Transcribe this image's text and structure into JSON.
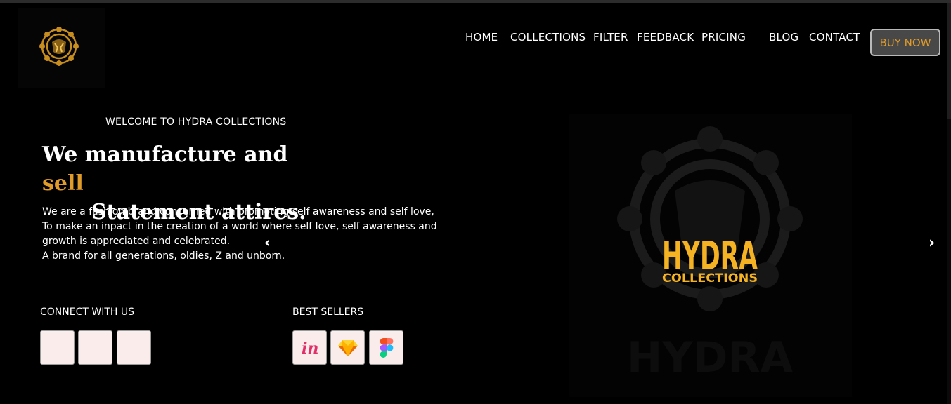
{
  "nav": {
    "items": [
      {
        "label": "HOME",
        "name": "nav-home"
      },
      {
        "label": "COLLECTIONS",
        "name": "nav-collections"
      },
      {
        "label": "FILTER",
        "name": "nav-filter"
      },
      {
        "label": "FEEDBACK",
        "name": "nav-feedback"
      },
      {
        "label": "PRICING",
        "name": "nav-pricing"
      },
      {
        "label": "BLOG",
        "name": "nav-blog"
      },
      {
        "label": "CONTACT",
        "name": "nav-contact"
      }
    ],
    "buy_label": "BUY NOW"
  },
  "hero": {
    "welcome": "WELCOME TO HYDRA COLLECTIONS",
    "headline_part1": "We manufacture and ",
    "headline_accent": "sell",
    "headline_line2": "Statement attires.",
    "description": [
      "We are a fashion brand concerned with promoting self awareness and self love,",
      "To make an inpact in the creation of a world where self love, self awareness and",
      "growth is appreciated and celebrated.",
      "A brand for all generations, oldies, Z and unborn."
    ]
  },
  "connect": {
    "title": "CONNECT WITH US",
    "icons": [
      "social-icon-1",
      "social-icon-2",
      "social-icon-3"
    ]
  },
  "best_sellers": {
    "title": "BEST SELLERS",
    "icons": [
      "invision-icon",
      "sketch-icon",
      "figma-icon"
    ]
  },
  "carousel": {
    "prev": "‹",
    "next": "›",
    "brand_main": "HYDRA",
    "brand_sub": "COLLECTIONS"
  },
  "colors": {
    "accent": "#e09b2a",
    "background": "#000000",
    "tile": "#f9eceb",
    "button_bg": "#484848"
  }
}
